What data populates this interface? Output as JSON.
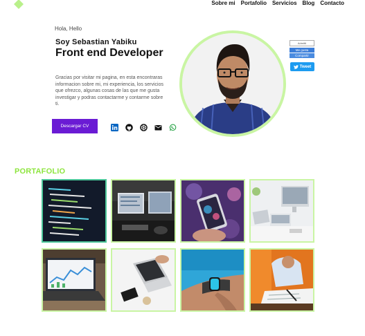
{
  "nav": {
    "items": [
      "Sobre mi",
      "Portafolio",
      "Servicios",
      "Blog",
      "Contacto"
    ]
  },
  "hero": {
    "greeting": "Hola, Hello",
    "name": "Soy Sebastian Yabiku",
    "role": "Front end Developer",
    "intro": "Gracias por visitar mi pagina, en esta encontraras informacion sobre mi, mi experiencia, los servicios que ofrezco, algunas cosas de las que me gusta investigar y podras contactarme y contarme sobre ti.",
    "cv_button": "Descargar CV"
  },
  "socials": [
    "linkedin-icon",
    "github-icon",
    "codepen-icon",
    "mail-icon",
    "whatsapp-icon"
  ],
  "widget": {
    "small_label": "Admitti",
    "follow": "Me gusta",
    "share": "Compartir",
    "tweet": "Tweet"
  },
  "portfolio": {
    "title": "PORTAFOLIO"
  },
  "colors": {
    "accent_green": "#8ee53f",
    "border_green": "#c9f5a3",
    "button_purple": "#6a1bd4",
    "twitter_blue": "#1d9bf0"
  }
}
